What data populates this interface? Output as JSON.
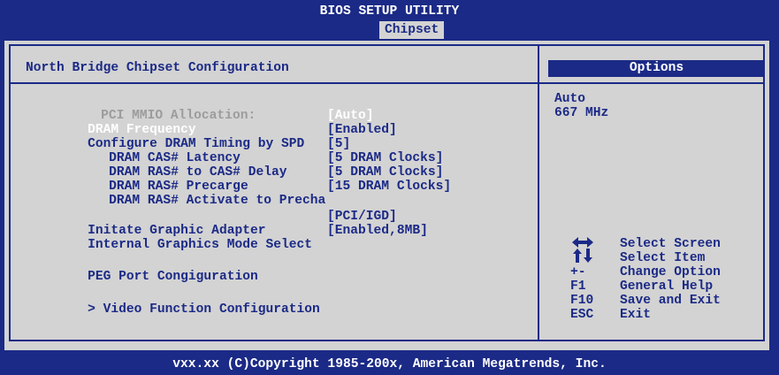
{
  "title": {
    "app_name": "BIOS SETUP UTILITY",
    "active_tab": "Chipset"
  },
  "main": {
    "heading": "North Bridge Chipset Configuration",
    "rows": [
      {
        "label": "PCI MMIO Allocation:",
        "value": "",
        "state": "disabled"
      },
      {
        "label": "DRAM Frequency",
        "value": "[Auto]",
        "state": "selected"
      },
      {
        "label": "Configure DRAM Timing by SPD",
        "value": "[Enabled]",
        "state": "normal"
      },
      {
        "label": "DRAM CAS# Latency",
        "value": "[5]",
        "state": "normal"
      },
      {
        "label": "DRAM RAS# to CAS# Delay",
        "value": "[5 DRAM Clocks]",
        "state": "normal"
      },
      {
        "label": "DRAM RAS# Precarge",
        "value": "[5 DRAM Clocks]",
        "state": "normal"
      },
      {
        "label": "DRAM RAS# Activate to Precha",
        "value": "[15 DRAM Clocks]",
        "state": "normal"
      },
      {
        "label": "Initate Graphic Adapter",
        "value": "[PCI/IGD]",
        "state": "normal"
      },
      {
        "label": "Internal Graphics Mode Select",
        "value": "[Enabled,8MB]",
        "state": "normal"
      },
      {
        "label": "PEG Port Congiguration",
        "value": "",
        "state": "normal"
      },
      {
        "label": "> Video Function Configuration",
        "value": "",
        "state": "normal"
      }
    ]
  },
  "options": {
    "heading": "Options",
    "items": [
      "Auto",
      "667 MHz"
    ]
  },
  "hotkeys": [
    {
      "key": "",
      "icon": "left-right-arrows-icon",
      "action": "Select Screen"
    },
    {
      "key": "",
      "icon": "up-down-arrows-icon",
      "action": "Select Item"
    },
    {
      "key": "+-",
      "action": "Change Option"
    },
    {
      "key": "F1",
      "action": "General Help"
    },
    {
      "key": "F10",
      "action": "Save and Exit"
    },
    {
      "key": "ESC",
      "action": "Exit"
    }
  ],
  "footer": {
    "copyright": "vxx.xx (C)Copyright 1985-200x, American Megatrends, Inc."
  },
  "colors": {
    "background": "#1b2a86",
    "panel": "#d3d3d3",
    "text": "#1b2a86",
    "selected_text": "#ffffff",
    "disabled_text": "#9c9c9c"
  }
}
